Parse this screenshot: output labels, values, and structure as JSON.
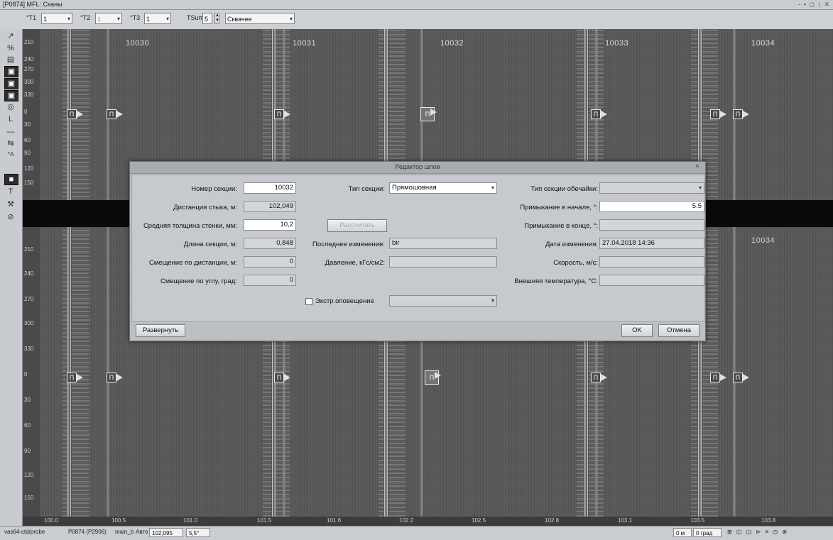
{
  "window": {
    "title": "[P0874] MFL: Сканы",
    "controls": "- ▪ ◻ ↕ ✕"
  },
  "toolbar": {
    "t1_label": "°T1",
    "t1_value": "1",
    "t2_label": "°T2",
    "t2_value": "1",
    "t3_label": "°T3",
    "t3_value": "1",
    "tsum_label": "TSum",
    "tsum_value": "5",
    "mode_value": "Сквачее"
  },
  "left_tools": [
    "↗",
    "%",
    "▤",
    "▣",
    "▣",
    "▣",
    "◎",
    "L",
    "—",
    "⇆",
    "^A",
    "■",
    "T",
    "⚒",
    "⊘"
  ],
  "ruler_labels_top": [
    "210",
    "240",
    "270",
    "300",
    "330",
    "0",
    "30",
    "60",
    "90",
    "120",
    "150"
  ],
  "ruler_labels_bottom": [
    "210",
    "240",
    "270",
    "300",
    "330",
    "0",
    "30",
    "60",
    "90",
    "120",
    "150"
  ],
  "section_labels": [
    "10030",
    "10031",
    "10032",
    "10033",
    "10034"
  ],
  "section_label_lower": "10034",
  "marker_glyph": "П",
  "axis_bottom": [
    "100.0",
    "100.5",
    "101.0",
    "101.5",
    "101.6",
    "102.2",
    "102.5",
    "102.8",
    "103.1",
    "103.5",
    "103.8"
  ],
  "dialog": {
    "title": "Редактор шпов",
    "close": "×",
    "section_number_label": "Номер секции:",
    "section_number": "10032",
    "joint_distance_label": "Дистанция стыка, м:",
    "joint_distance": "102,049",
    "avg_wall_label": "Средняя толщина стенки, мм:",
    "avg_wall": "10,2",
    "section_length_label": "Длина секции, м:",
    "section_length": "0,848",
    "dist_offset_label": "Смещение по дистанции, м:",
    "dist_offset": "0",
    "angle_offset_label": "Смещение по углу, град:",
    "angle_offset": "0",
    "section_type_label": "Тип секции:",
    "section_type": "Прямошовная",
    "recalc_button": "Рассчитать",
    "last_change_label": "Последнее изменение:",
    "last_change": "bir",
    "pressure_label": "Давление, кГс/см2:",
    "pressure": "",
    "extra_alert_label": "Экстр.оповещение",
    "extra_alert_value": "",
    "shell_type_label": "Тип секции обечайки:",
    "shell_type": "",
    "adj_start_label": "Примыкание в начале, °:",
    "adj_start": "5.5",
    "adj_end_label": "Примыкание в конце, °:",
    "adj_end": "",
    "change_date_label": "Дата изменения:",
    "change_date": "27.04.2018 14:36",
    "speed_label": "Скорость, м/с:",
    "speed": "",
    "ext_temp_label": "Внешняя температура, °С:",
    "ext_temp": "",
    "expand_button": "Развернуть",
    "ok_button": "OK",
    "cancel_button": "Отмена"
  },
  "status": {
    "host": "vas64-ctd/probe",
    "probe": "P0874 (P2906)",
    "file": "main_b",
    "auto_label": "Авто",
    "auto_value": "102,095",
    "angle": "5,5°",
    "pos": "0 м",
    "grad": "0 град",
    "icons": "⊞ ◫ ◲ ⊳ ≡ ◷ ⊗"
  }
}
